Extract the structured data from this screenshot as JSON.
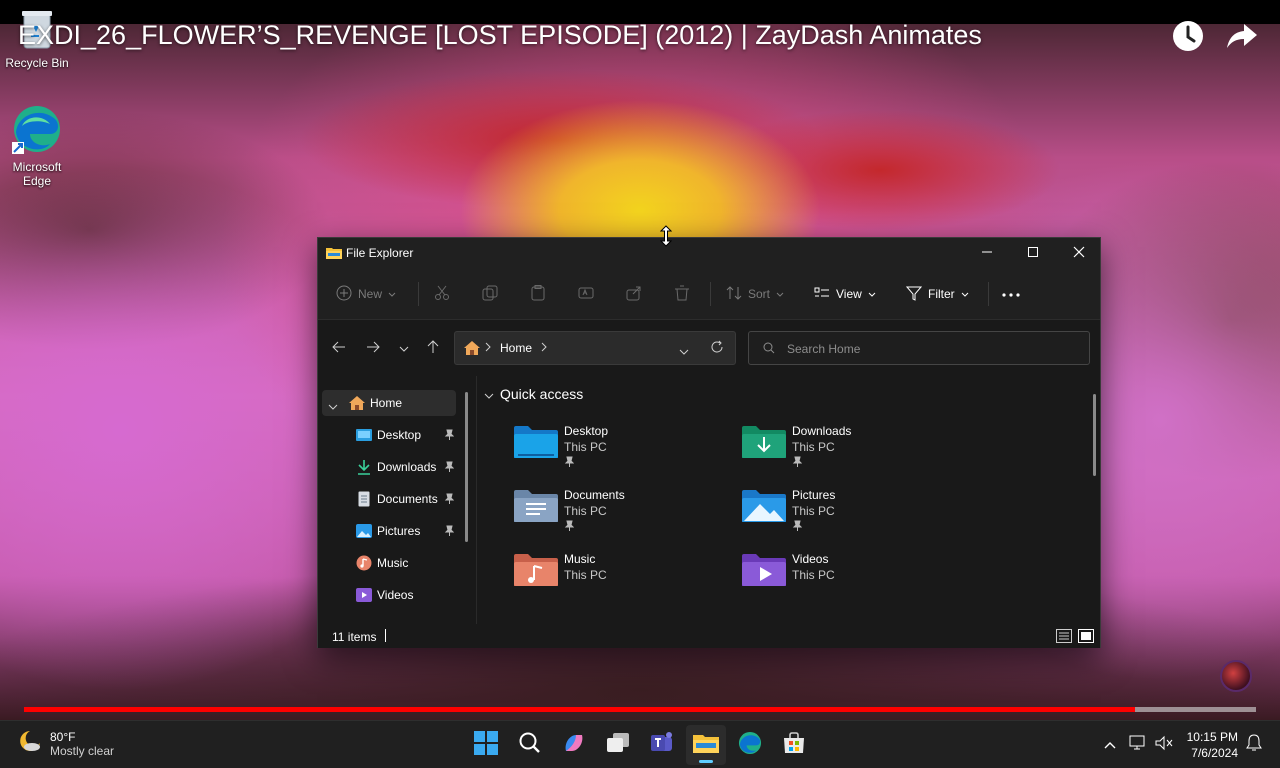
{
  "video": {
    "title": "EXDI_26_FLOWER’S_REVENGE [LOST EPISODE] (2012) | ZayDash Animates",
    "progress_fraction": 0.902,
    "watch_later_icon": "clock-icon",
    "share_icon": "share-arrow-icon"
  },
  "desktop": {
    "icons": [
      {
        "label": "Recycle Bin",
        "icon": "recycle-bin-icon"
      },
      {
        "label": "Microsoft Edge",
        "icon": "edge-icon"
      }
    ]
  },
  "explorer": {
    "window_title": "File Explorer",
    "toolbar": {
      "new_label": "New",
      "sort_label": "Sort",
      "view_label": "View",
      "filter_label": "Filter"
    },
    "address": {
      "location": "Home"
    },
    "search": {
      "placeholder": "Search Home"
    },
    "sidebar": {
      "items": [
        {
          "label": "Home",
          "icon": "home-icon",
          "pinned": false
        },
        {
          "label": "Desktop",
          "icon": "desktop-folder-icon",
          "pinned": true
        },
        {
          "label": "Downloads",
          "icon": "download-icon",
          "pinned": true
        },
        {
          "label": "Documents",
          "icon": "documents-icon",
          "pinned": true
        },
        {
          "label": "Pictures",
          "icon": "pictures-icon",
          "pinned": true
        },
        {
          "label": "Music",
          "icon": "music-icon",
          "pinned": false
        },
        {
          "label": "Videos",
          "icon": "videos-icon",
          "pinned": false
        }
      ]
    },
    "quick_access": {
      "header": "Quick access",
      "items": [
        {
          "name": "Desktop",
          "location": "This PC",
          "pinned": true,
          "color": "#1aa3e8"
        },
        {
          "name": "Downloads",
          "location": "This PC",
          "pinned": true,
          "color": "#1fa37a"
        },
        {
          "name": "Documents",
          "location": "This PC",
          "pinned": true,
          "color": "#8aa4c4"
        },
        {
          "name": "Pictures",
          "location": "This PC",
          "pinned": true,
          "color": "#2a9ae8"
        },
        {
          "name": "Music",
          "location": "This PC",
          "pinned": false,
          "color": "#e8846a"
        },
        {
          "name": "Videos",
          "location": "This PC",
          "pinned": false,
          "color": "#8a5ad8"
        }
      ]
    },
    "status": {
      "item_count": "11 items"
    }
  },
  "taskbar": {
    "weather": {
      "temp": "80°F",
      "condition": "Mostly clear"
    },
    "apps": [
      "start-icon",
      "search-icon",
      "copilot-icon",
      "task-view-icon",
      "teams-icon",
      "file-explorer-icon",
      "edge-icon",
      "store-icon"
    ],
    "clock": {
      "time": "10:15 PM",
      "date": "7/6/2024"
    }
  },
  "colors": {
    "accent": "#60cdff",
    "progress": "#ff0000",
    "window_bg": "#191919"
  }
}
